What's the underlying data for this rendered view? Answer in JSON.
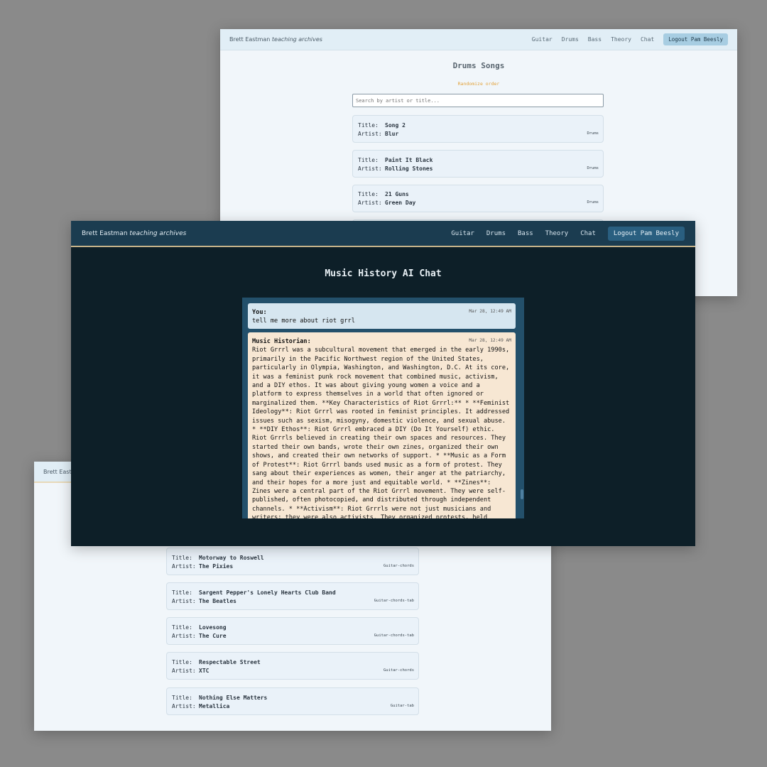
{
  "brand": {
    "name": "Brett Eastman",
    "suffix": "teaching archives"
  },
  "nav": {
    "links": [
      "Guitar",
      "Drums",
      "Bass",
      "Theory",
      "Chat"
    ],
    "logout": "Logout Pam Beesly"
  },
  "drums_window": {
    "heading": "Drums Songs",
    "randomize": "Randomize order",
    "search_placeholder": "Search by artist or title...",
    "songs": [
      {
        "title": "Song 2",
        "artist": "Blur",
        "tag": "Drums"
      },
      {
        "title": "Paint It Black",
        "artist": "Rolling Stones",
        "tag": "Drums"
      },
      {
        "title": "21 Guns",
        "artist": "Green Day",
        "tag": "Drums"
      }
    ]
  },
  "guitar_window": {
    "brand_partial": "Brett East",
    "songs": [
      {
        "title": "Motorway to Roswell",
        "artist": "The Pixies",
        "tag": "Guitar-chords"
      },
      {
        "title": "Sargent Pepper's Lonely Hearts Club Band",
        "artist": "The Beatles",
        "tag": "Guitar-chords-tab"
      },
      {
        "title": "Lovesong",
        "artist": "The Cure",
        "tag": "Guitar-chords-tab"
      },
      {
        "title": "Respectable Street",
        "artist": "XTC",
        "tag": "Guitar-chords"
      },
      {
        "title": "Nothing Else Matters",
        "artist": "Metallica",
        "tag": "Guitar-tab"
      }
    ]
  },
  "labels": {
    "title": "Title:",
    "artist": "Artist:"
  },
  "chat_window": {
    "heading": "Music History AI Chat",
    "messages": [
      {
        "sender": "You:",
        "time": "Mar 28, 12:49 AM",
        "text": "tell me more about riot grrl"
      },
      {
        "sender": "Music Historian:",
        "time": "Mar 28, 12:49 AM",
        "text": "Riot Grrrl was a subcultural movement that emerged in the early 1990s, primarily in the Pacific Northwest region of the United States, particularly in Olympia, Washington, and Washington, D.C. At its core, it was a feminist punk rock movement that combined music, activism, and a DIY ethos. It was about giving young women a voice and a platform to express themselves in a world that often ignored or marginalized them. **Key Characteristics of Riot Grrrl:** * **Feminist Ideology**: Riot Grrrl was rooted in feminist principles. It addressed issues such as sexism, misogyny, domestic violence, and sexual abuse. * **DIY Ethos**: Riot Grrrl embraced a DIY (Do It Yourself) ethic. Riot Grrrls believed in creating their own spaces and resources. They started their own bands, wrote their own zines, organized their own shows, and created their own networks of support. * **Music as a Form of Protest**: Riot Grrrl bands used music as a form of protest. They sang about their experiences as women, their anger at the patriarchy, and their hopes for a more just and equitable world. * **Zines**: Zines were a central part of the Riot Grrrl movement. They were self-published, often photocopied, and distributed through independent channels. * **Activism**: Riot Grrrls were not just musicians and writers; they were also activists. They organized protests, held workshops, and engaged in direct action to challenge sexism and"
      }
    ]
  },
  "colors": {
    "backdrop": "#8a8a8a",
    "light_bg": "#f1f6fa",
    "dark_bg": "#0d1f28",
    "dark_nav": "#1b3c50",
    "accent_gold": "#c6b38a",
    "user_bubble": "#d6e6f0",
    "ai_bubble": "#f7e7d3",
    "randomize": "#e3a23a"
  }
}
